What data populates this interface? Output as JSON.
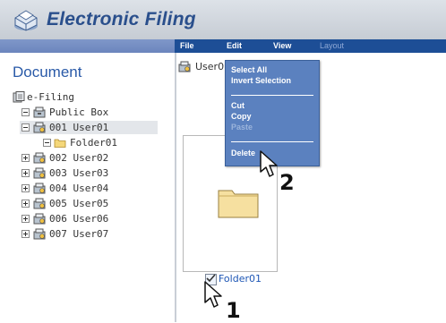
{
  "app": {
    "title": "Electronic Filing"
  },
  "menubar": {
    "items": [
      {
        "label": "File",
        "enabled": true
      },
      {
        "label": "Edit",
        "enabled": true
      },
      {
        "label": "View",
        "enabled": true
      },
      {
        "label": "Layout",
        "enabled": false
      }
    ]
  },
  "sidebar": {
    "title": "Document",
    "tree": [
      {
        "label": "e-Filing",
        "expander": "none",
        "icon": "efiling-icon"
      },
      {
        "label": "Public Box",
        "expander": "minus",
        "icon": "public-box-icon"
      },
      {
        "label": "001 User01",
        "expander": "minus",
        "icon": "user-box-icon",
        "selected": true
      },
      {
        "label": "Folder01",
        "expander": "minus",
        "icon": "folder-icon"
      },
      {
        "label": "002 User02",
        "expander": "plus",
        "icon": "user-box-icon"
      },
      {
        "label": "003 User03",
        "expander": "plus",
        "icon": "user-box-icon"
      },
      {
        "label": "004 User04",
        "expander": "plus",
        "icon": "user-box-icon"
      },
      {
        "label": "005 User05",
        "expander": "plus",
        "icon": "user-box-icon"
      },
      {
        "label": "006 User06",
        "expander": "plus",
        "icon": "user-box-icon"
      },
      {
        "label": "007 User07",
        "expander": "plus",
        "icon": "user-box-icon"
      }
    ]
  },
  "main": {
    "breadcrumb": "User01",
    "folder": {
      "label": "Folder01",
      "checked": true
    }
  },
  "dropdown": {
    "items": [
      {
        "label": "Select All",
        "enabled": true
      },
      {
        "label": "Invert Selection",
        "enabled": true
      },
      {
        "label": "Cut",
        "enabled": true
      },
      {
        "label": "Copy",
        "enabled": true
      },
      {
        "label": "Paste",
        "enabled": false
      },
      {
        "label": "Delete",
        "enabled": true
      }
    ]
  },
  "steps": {
    "first": "1",
    "second": "2"
  },
  "colors": {
    "accent": "#2a4f8c",
    "menubar": "#1d4e96",
    "dropdown": "#5b81bf",
    "link": "#1d56b5"
  }
}
